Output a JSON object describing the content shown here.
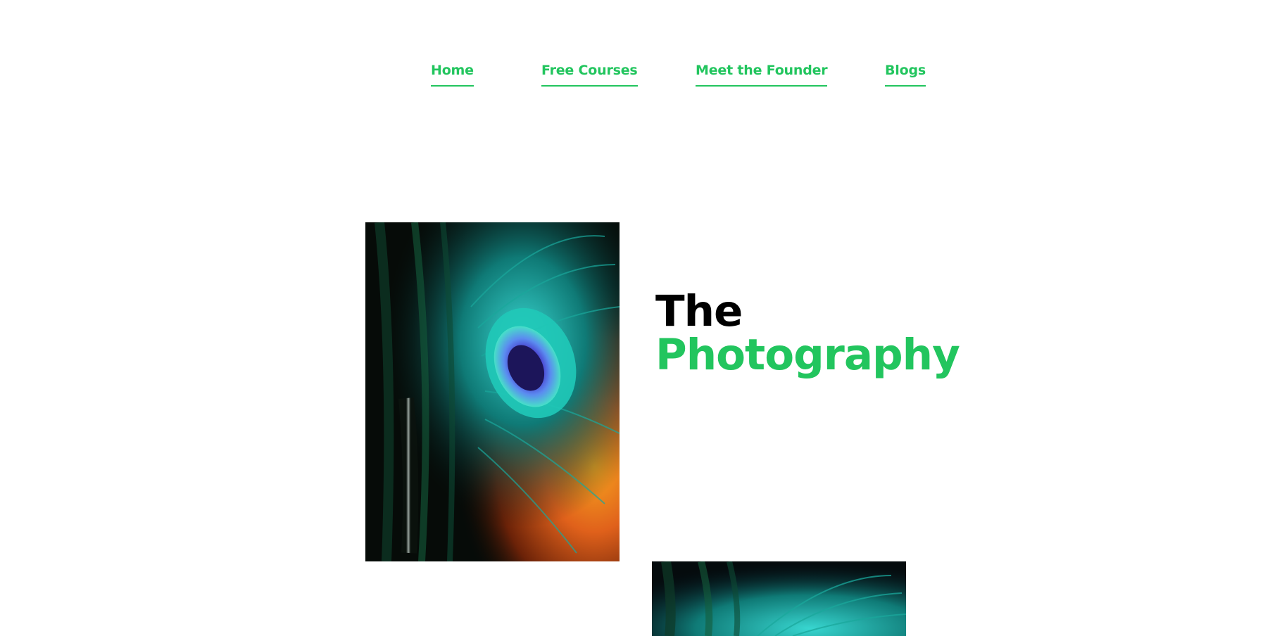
{
  "nav": {
    "items": [
      {
        "label": "Home"
      },
      {
        "label": "Free Courses"
      },
      {
        "label": "Meet the Founder"
      },
      {
        "label": "Blogs"
      }
    ]
  },
  "hero": {
    "title_line_1": "The",
    "title_line_2": "Photography",
    "image_subject": "peacock-feather"
  },
  "colors": {
    "accent": "#22c55e",
    "text": "#000000",
    "background": "#ffffff"
  }
}
